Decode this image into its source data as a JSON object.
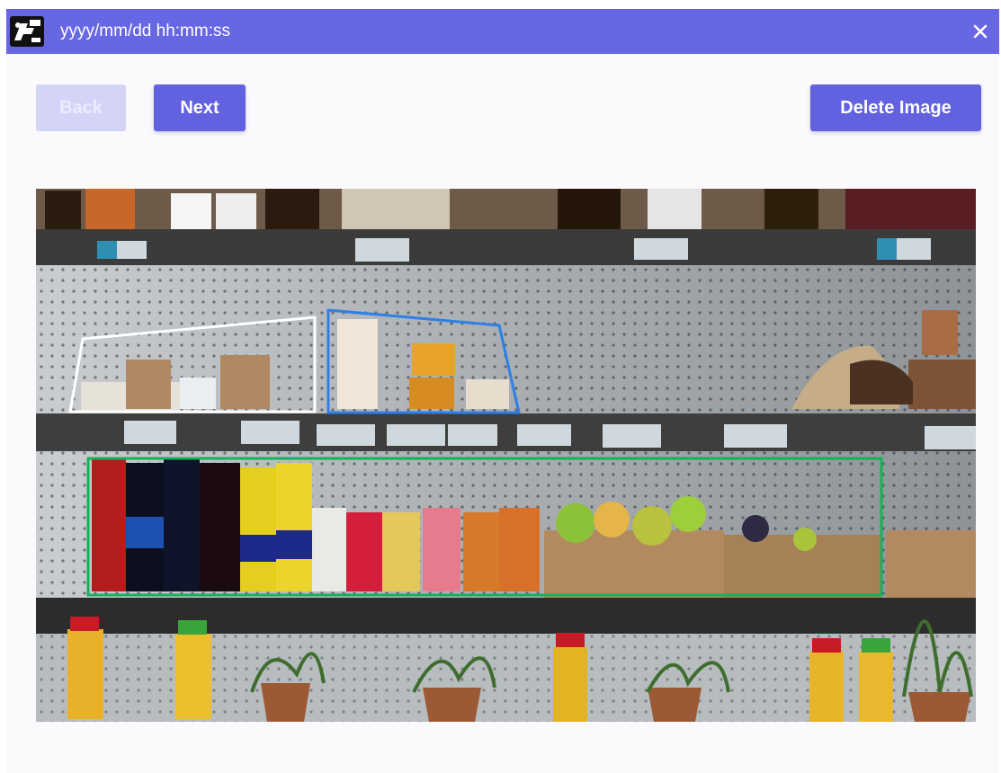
{
  "window": {
    "title": "yyyy/mm/dd hh:mm:ss",
    "icon": "app-logo-icon",
    "close_icon": "close-icon"
  },
  "toolbar": {
    "back_label": "Back",
    "next_label": "Next",
    "delete_label": "Delete Image"
  },
  "colors": {
    "titlebar": "#6767e4",
    "button_primary": "#6262e0",
    "button_disabled": "#d4d4f8"
  },
  "annotations": [
    {
      "label": "white-box",
      "color": "#ffffff"
    },
    {
      "label": "blue-box",
      "color": "#2f7fe6"
    },
    {
      "label": "green-box",
      "color": "#18b05a"
    }
  ]
}
